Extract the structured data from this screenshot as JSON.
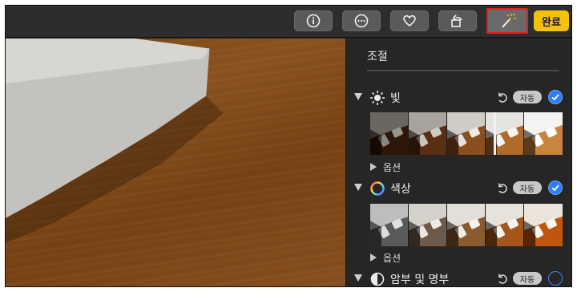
{
  "toolbar": {
    "buttons": [
      {
        "name": "info",
        "icon": "info-icon"
      },
      {
        "name": "more",
        "icon": "ellipsis-icon"
      },
      {
        "name": "favorite",
        "icon": "heart-icon"
      },
      {
        "name": "rotate",
        "icon": "rotate-icon"
      },
      {
        "name": "auto-enhance",
        "icon": "magic-wand-icon",
        "highlighted": true
      }
    ],
    "done_label": "완료"
  },
  "panel": {
    "title": "조절",
    "sections": [
      {
        "name": "light",
        "icon": "sun-icon",
        "label": "빛",
        "auto_label": "자동",
        "enabled": true,
        "options_label": "옵션",
        "expanded": true
      },
      {
        "name": "color",
        "icon": "color-wheel-icon",
        "label": "색상",
        "auto_label": "자동",
        "enabled": true,
        "options_label": "옵션",
        "expanded": true
      },
      {
        "name": "black-white",
        "icon": "half-circle-icon",
        "label": "암부 및 명부",
        "auto_label": "자동",
        "enabled": false,
        "expanded": true
      }
    ]
  },
  "colors": {
    "accent": "#2f7cf6",
    "done_button": "#f4c20d",
    "highlight_border": "#e02020",
    "panel_bg": "#262626",
    "toolbar_bg": "#2d2d2d"
  }
}
